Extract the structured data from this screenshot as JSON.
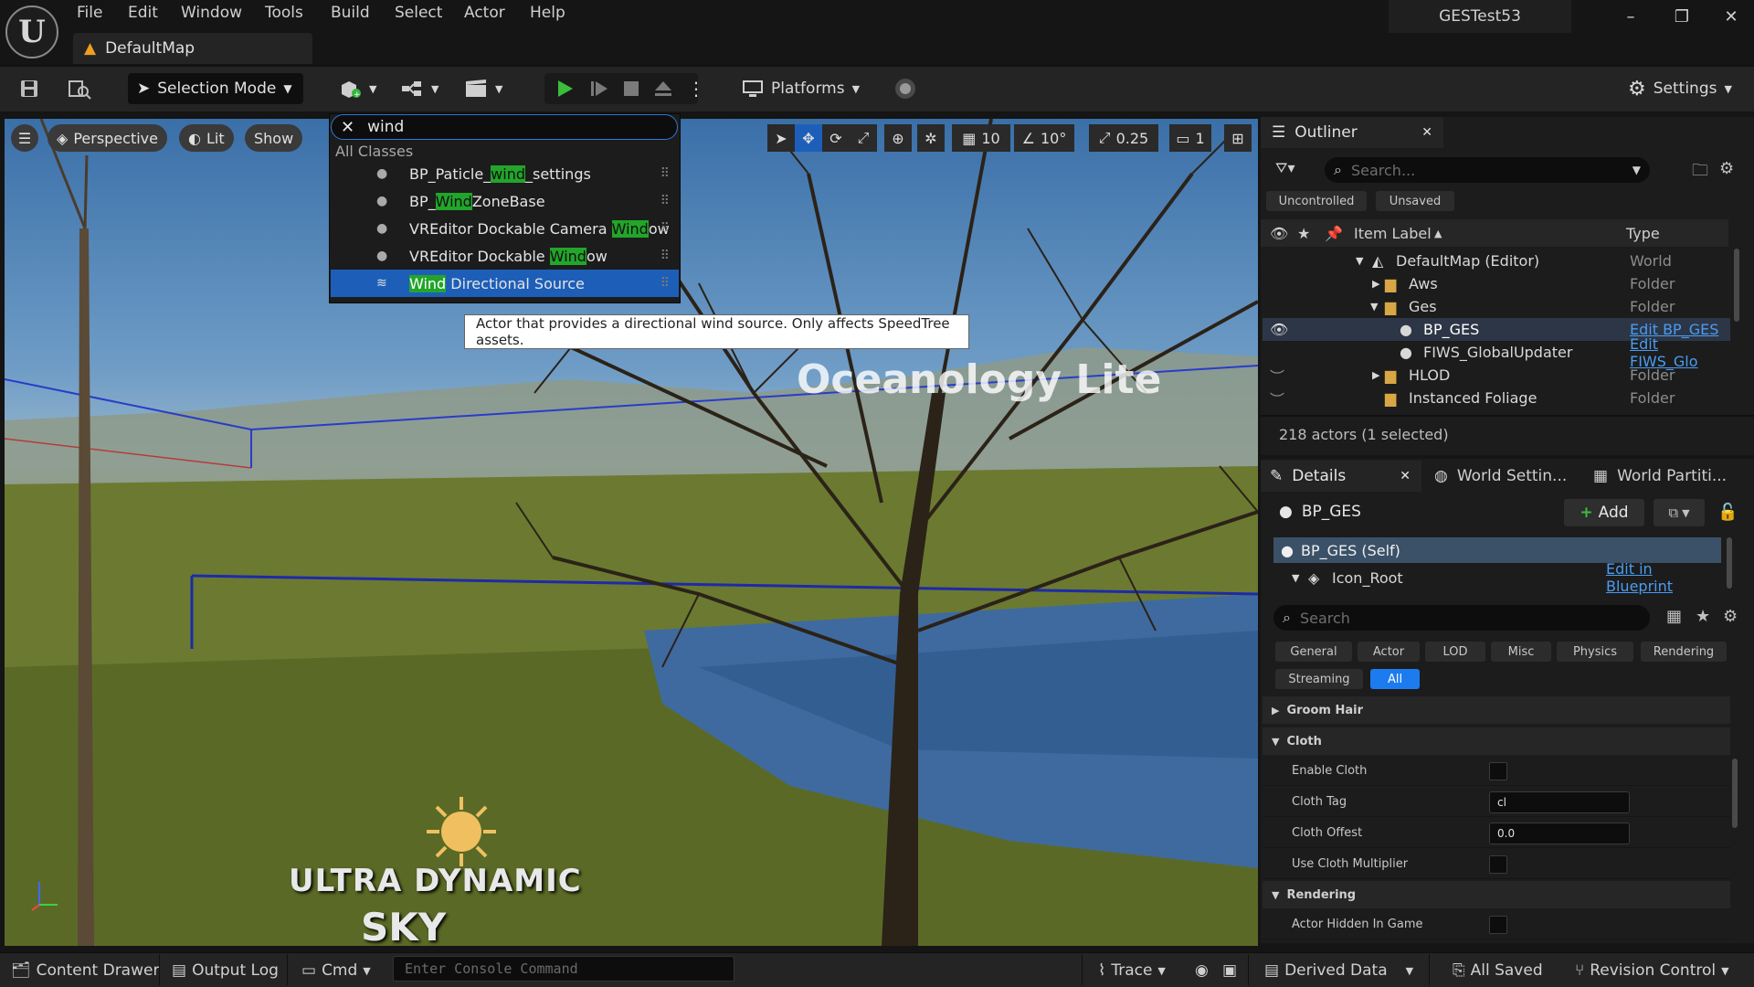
{
  "menu": [
    "File",
    "Edit",
    "Window",
    "Tools",
    "Build",
    "Select",
    "Actor",
    "Help"
  ],
  "map_tab": "DefaultMap",
  "project": "GESTest53",
  "toolbar": {
    "selection_mode": "Selection Mode",
    "platforms": "Platforms",
    "settings": "Settings"
  },
  "viewport": {
    "perspective": "Perspective",
    "lit": "Lit",
    "show": "Show",
    "grid_snap": "10",
    "rot_snap": "10°",
    "scale_snap": "0.25",
    "camera_speed": "1",
    "scene_text": "Oceanology Lite",
    "logo_line1": "ULTRA DYNAMIC",
    "logo_line2": "SKY"
  },
  "search": {
    "query": "wind",
    "section": "All Classes",
    "results": [
      {
        "pre": "BP_Paticle_",
        "hit": "wind",
        "post": "_settings"
      },
      {
        "pre": "BP_",
        "hit": "Wind",
        "post": "ZoneBase"
      },
      {
        "pre": "VREditor Dockable Camera ",
        "hit": "Wind",
        "post": "ow"
      },
      {
        "pre": "VREditor Dockable ",
        "hit": "Wind",
        "post": "ow"
      },
      {
        "pre": "",
        "hit": "Wind",
        "post": " Directional Source"
      }
    ],
    "tooltip": "Actor that provides a directional wind source. Only affects SpeedTree assets."
  },
  "outliner": {
    "title": "Outliner",
    "search_placeholder": "Search...",
    "chips": [
      "Uncontrolled",
      "Unsaved"
    ],
    "col_label": "Item Label",
    "col_type": "Type",
    "rows": [
      {
        "label": "DefaultMap (Editor)",
        "type": "World"
      },
      {
        "label": "Aws",
        "type": "Folder"
      },
      {
        "label": "Ges",
        "type": "Folder"
      },
      {
        "label": "BP_GES",
        "type": "Edit BP_GES"
      },
      {
        "label": "FIWS_GlobalUpdater",
        "type": "Edit FIWS_Glo"
      },
      {
        "label": "HLOD",
        "type": "Folder"
      },
      {
        "label": "Instanced Foliage",
        "type": "Folder"
      }
    ],
    "count": "218 actors (1 selected)"
  },
  "details": {
    "tabs": [
      "Details",
      "World Settin...",
      "World Partiti..."
    ],
    "object": "BP_GES",
    "add": "Add",
    "self": "BP_GES (Self)",
    "root": "Icon_Root",
    "edit_bp": "Edit in Blueprint",
    "search_placeholder": "Search",
    "filters": [
      "General",
      "Actor",
      "LOD",
      "Misc",
      "Physics",
      "Rendering",
      "Streaming",
      "All"
    ],
    "cat_groom": "Groom Hair",
    "cat_cloth": "Cloth",
    "enable_cloth": "Enable Cloth",
    "cloth_tag": "Cloth Tag",
    "cloth_tag_val": "cl",
    "cloth_offset": "Cloth Offest",
    "cloth_offset_val": "0.0",
    "use_cloth_mult": "Use Cloth Multiplier",
    "cat_rendering": "Rendering",
    "actor_hidden": "Actor Hidden In Game"
  },
  "statusbar": {
    "content_drawer": "Content Drawer",
    "output_log": "Output Log",
    "cmd": "Cmd",
    "console_placeholder": "Enter Console Command",
    "trace": "Trace",
    "derived_data": "Derived Data",
    "all_saved": "All Saved",
    "revision_control": "Revision Control"
  },
  "colors": {
    "accent": "#1d7bf0",
    "highlight": "#22a52a",
    "selection": "#1d5fb8"
  }
}
